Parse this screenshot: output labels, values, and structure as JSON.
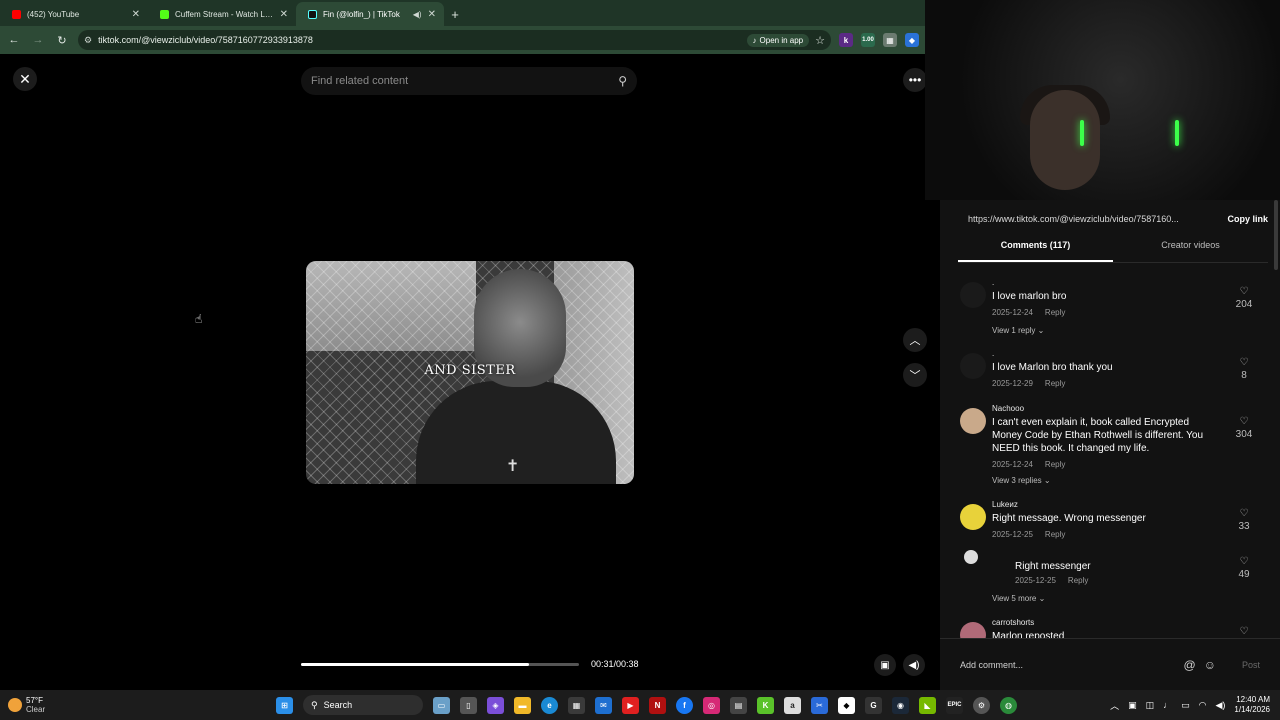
{
  "browser": {
    "tabs": [
      {
        "title": "(452) YouTube",
        "color": "#ff0000",
        "active": false
      },
      {
        "title": "Cuffem Stream - Watch Live on",
        "color": "#53fc18",
        "active": false
      },
      {
        "title": "Fin (@lolfin_) | TikTok",
        "color": "#111111",
        "active": true
      }
    ],
    "url": "tiktok.com/@viewziclub/video/7587160772933913878",
    "open_in_app": "Open in app"
  },
  "viewer": {
    "search_placeholder": "Find related content",
    "caption": "AND SISTER",
    "progress": 0.82,
    "time": "00:31/00:38"
  },
  "panel": {
    "link": "https://www.tiktok.com/@viewziclub/video/7587160...",
    "copy_link": "Copy link",
    "tabs": [
      "Comments (117)",
      "Creator videos"
    ],
    "comments": [
      {
        "name": ".",
        "text": "I love marlon bro",
        "date": "2025-12-24",
        "reply": "Reply",
        "likes": "204",
        "views": "View 1 reply"
      },
      {
        "name": ".",
        "text": "I love Marlon bro thank you",
        "date": "2025-12-29",
        "reply": "Reply",
        "likes": "8",
        "views": ""
      },
      {
        "name": "Nachooo",
        "text": "I can't even explain it, book called Encrypted Money Code by Ethan Rothwell is different. You NEED this book. It changed my life.",
        "date": "2025-12-24",
        "reply": "Reply",
        "likes": "304",
        "views": "View 3 replies"
      },
      {
        "name": "Lukeиz",
        "text": "Right message. Wrong messenger",
        "date": "2025-12-25",
        "reply": "Reply",
        "likes": "33",
        "views": ""
      },
      {
        "name": "",
        "text": "Right messenger",
        "date": "2025-12-25",
        "reply": "Reply",
        "likes": "49",
        "views": "View 5 more"
      },
      {
        "name": "carrotshorts",
        "text": "Marlon reposted",
        "date": "",
        "reply": "",
        "likes": "",
        "views": ""
      }
    ],
    "add_comment": "Add comment...",
    "post": "Post"
  },
  "taskbar": {
    "temp": "57°F",
    "condition": "Clear",
    "search": "Search",
    "time": "12:40 AM",
    "date": "1/14/2026"
  }
}
